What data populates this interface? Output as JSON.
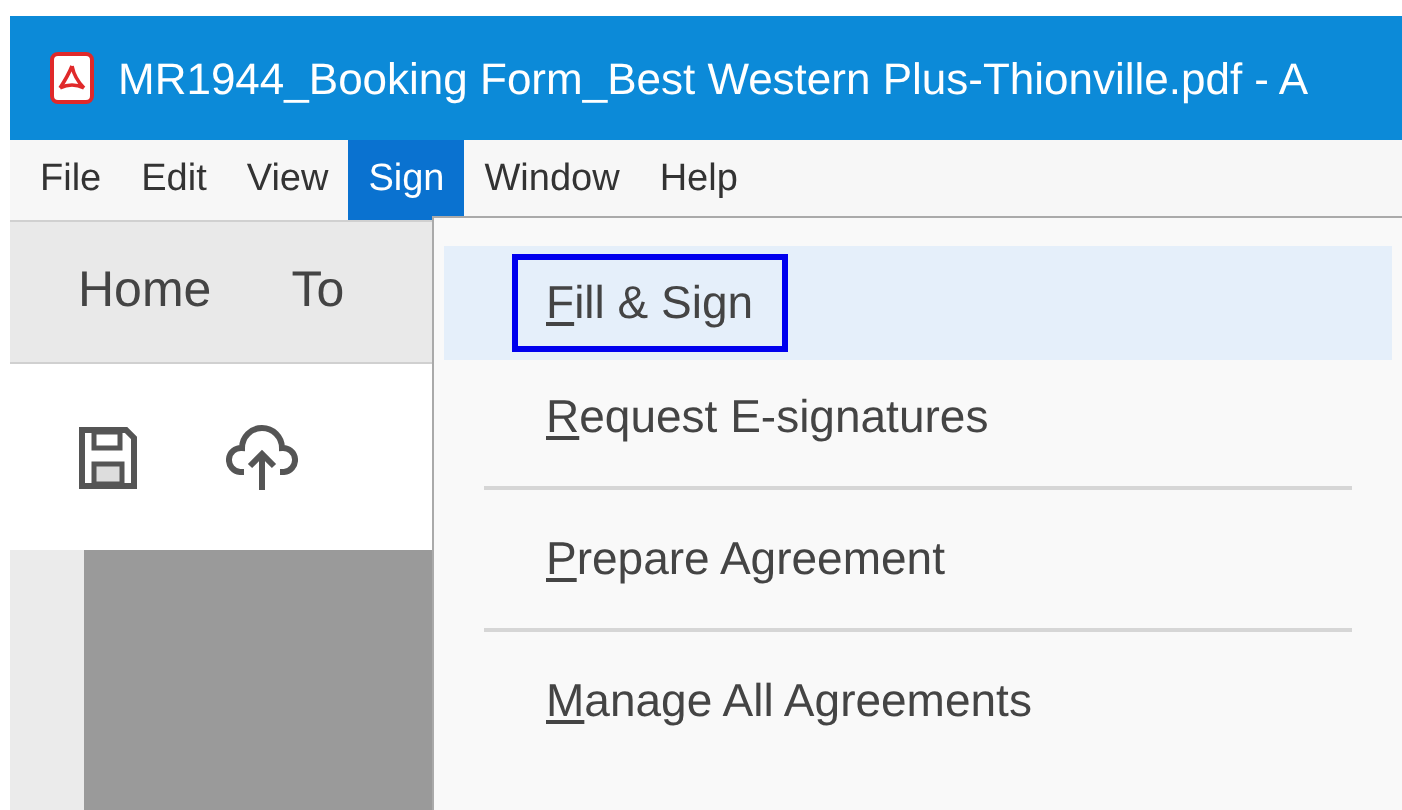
{
  "window": {
    "title": "MR1944_Booking Form_Best Western Plus-Thionville.pdf - A"
  },
  "menu_bar": [
    {
      "label": "File",
      "selected": false
    },
    {
      "label": "Edit",
      "selected": false
    },
    {
      "label": "View",
      "selected": false
    },
    {
      "label": "Sign",
      "selected": true
    },
    {
      "label": "Window",
      "selected": false
    },
    {
      "label": "Help",
      "selected": false
    }
  ],
  "tabs": [
    {
      "label": "Home"
    },
    {
      "label": "To"
    }
  ],
  "dropdown": [
    {
      "kind": "item",
      "label": "Fill & Sign",
      "selected": true
    },
    {
      "kind": "item",
      "label": "Request E-signatures",
      "selected": false
    },
    {
      "kind": "separator"
    },
    {
      "kind": "item",
      "label": "Prepare Agreement",
      "selected": false
    },
    {
      "kind": "separator"
    },
    {
      "kind": "item",
      "label": "Manage All Agreements",
      "selected": false
    }
  ]
}
